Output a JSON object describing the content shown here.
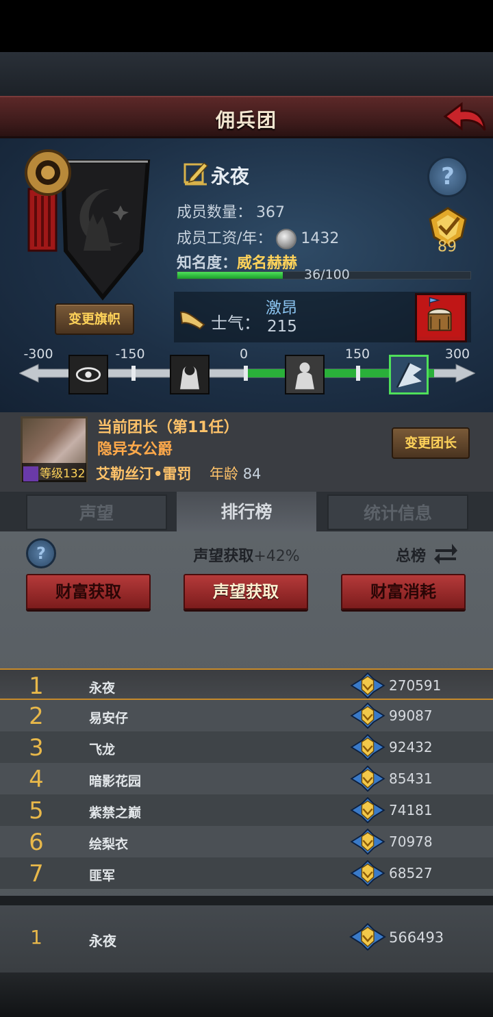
{
  "header": {
    "title": "佣兵团"
  },
  "guild": {
    "name": "永夜",
    "change_flag_label": "变更旗帜",
    "members_label": "成员数量：",
    "members_value": "367",
    "salary_label": "成员工资/年：",
    "salary_value": "1432",
    "fame_label": "知名度：",
    "fame_name": "威名赫赫",
    "fame_progress_text": "36/100",
    "fame_progress": 0.36,
    "badge_value": "89",
    "morale_label": "士气：",
    "morale_word": "激昂",
    "morale_value": "215"
  },
  "morale_scale": {
    "ticks": [
      "-300",
      "-150",
      "0",
      "150",
      "300"
    ],
    "current": 215
  },
  "leader": {
    "title": "当前团长（第11任）",
    "class": "隐异女公爵",
    "level_text": "等级132",
    "name": "艾勒丝汀•雷罚",
    "age_label": "年龄",
    "age_value": "84",
    "change_label": "变更团长"
  },
  "tabs": [
    {
      "label": "声望",
      "active": false
    },
    {
      "label": "排行榜",
      "active": true
    },
    {
      "label": "统计信息",
      "active": false
    }
  ],
  "ranking": {
    "bonus_label": "声望获取",
    "bonus_pct": "+42%",
    "scope_label": "总榜",
    "categories": [
      "财富获取",
      "声望获取",
      "财富消耗"
    ],
    "active_category": 1,
    "rows": [
      {
        "rank": "1",
        "name": "永夜",
        "score": "270591"
      },
      {
        "rank": "2",
        "name": "易安仔",
        "score": "99087"
      },
      {
        "rank": "3",
        "name": "飞龙",
        "score": "92432"
      },
      {
        "rank": "4",
        "name": "暗影花园",
        "score": "85431"
      },
      {
        "rank": "5",
        "name": "紫禁之巅",
        "score": "74181"
      },
      {
        "rank": "6",
        "name": "绘梨衣",
        "score": "70978"
      },
      {
        "rank": "7",
        "name": "匪军",
        "score": "68527"
      }
    ],
    "my_row": {
      "rank": "1",
      "name": "永夜",
      "score": "566493"
    }
  },
  "colors": {
    "accent_gold": "#ffd35a",
    "button_red": "#b53a3a",
    "morale_green": "#4fe05a",
    "rank_gold": "#e8b84a"
  }
}
